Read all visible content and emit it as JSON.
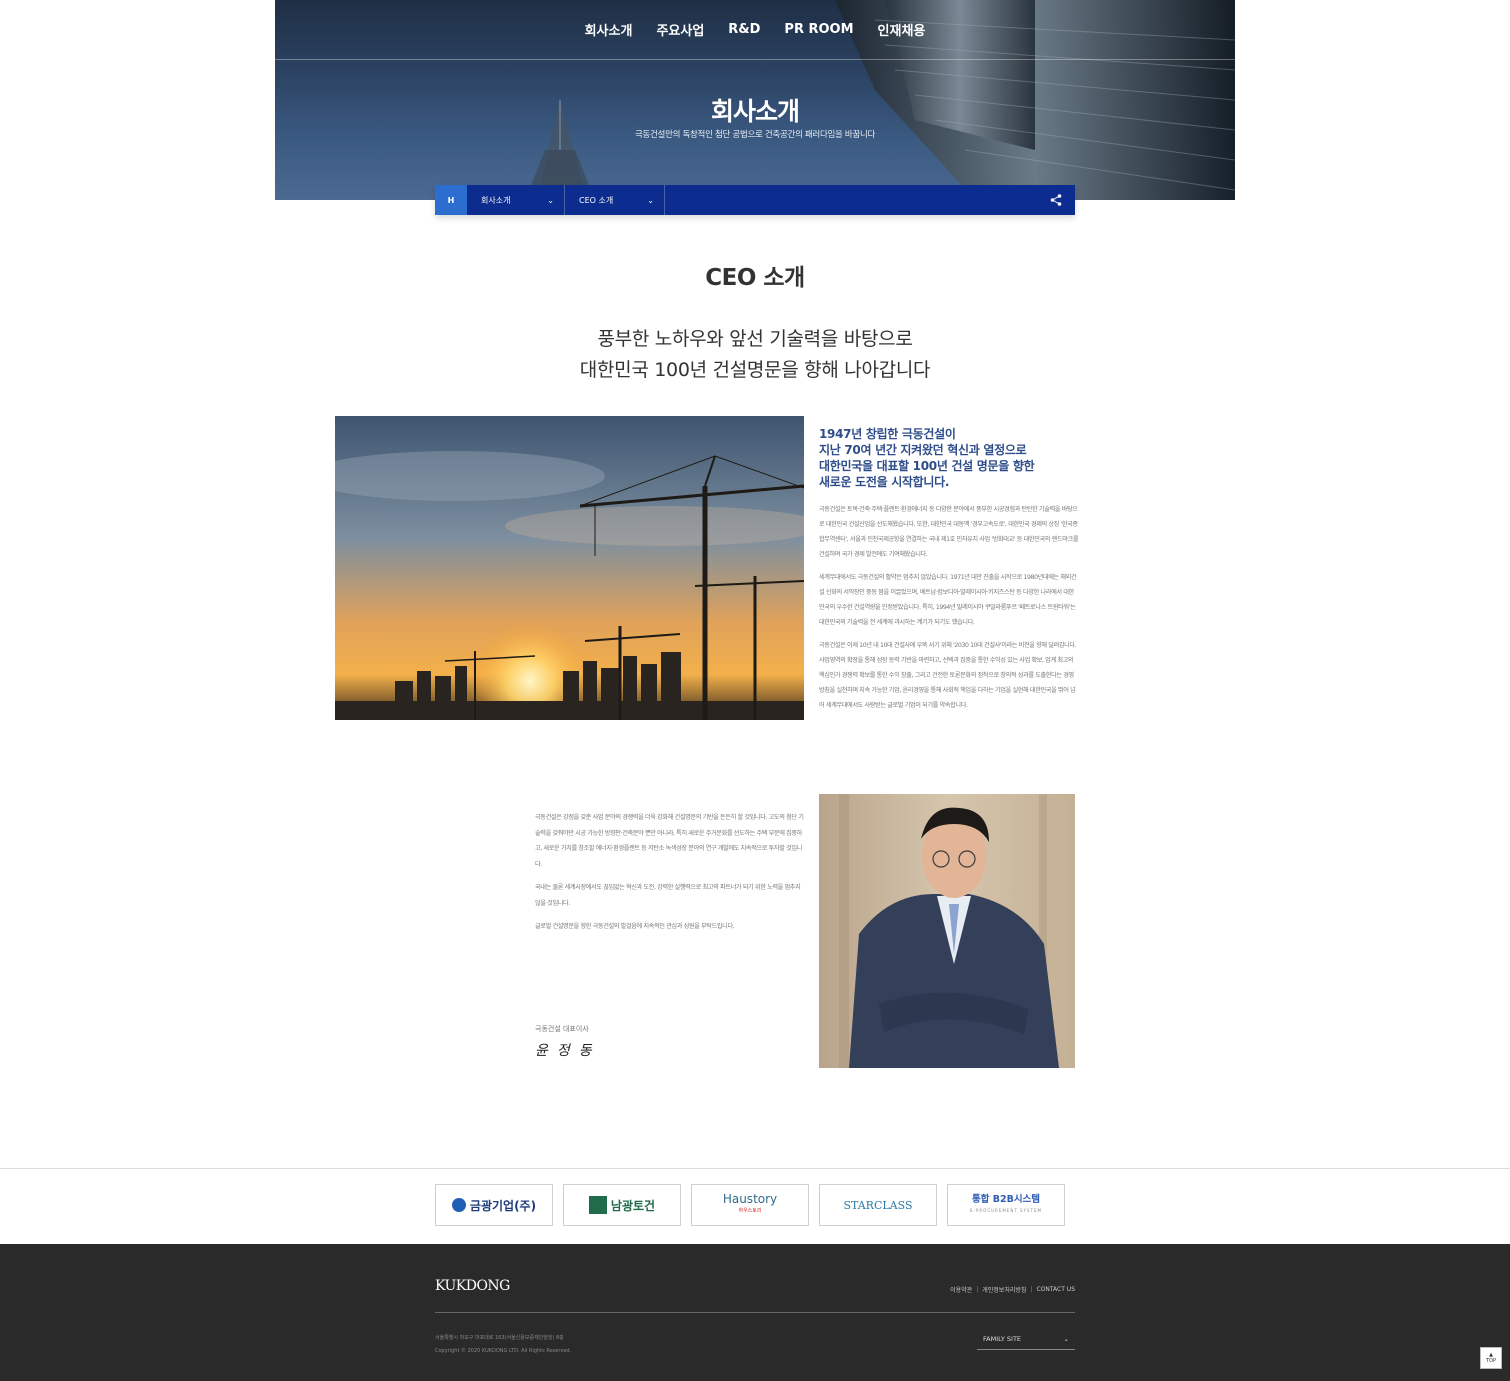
{
  "nav": {
    "items": [
      "회사소개",
      "주요사업",
      "R&D",
      "PR ROOM",
      "인재채용"
    ]
  },
  "hero": {
    "title": "회사소개",
    "subtitle": "극동건설만의 독창적인 첨단 공법으로 건축공간의 패러다임을 바꿉니다"
  },
  "location": {
    "home": "H",
    "depth1": "회사소개",
    "depth2": "CEO 소개"
  },
  "page": {
    "heading": "CEO 소개",
    "tagline_1": "풍부한 노하우와 앞선 기술력을 바탕으로",
    "tagline_2": "대한민국 100년 건설명문을 향해 나아갑니다"
  },
  "intro": {
    "headline": [
      "1947년 창립한 극동건설이",
      "지난 70여 년간 지켜왔던 혁신과 열정으로",
      "대한민국을 대표할 100년 건설 명문을 향한",
      "새로운 도전을 시작합니다."
    ],
    "paragraphs": [
      "극동건설은 토목·건축·주택·플랜트·환경에너지 등 다양한 분야에서 풍부한 시공경험과 탄탄한 기술력을 바탕으로 대한민국 건설산업을 선도해왔습니다. 또한, 대한민국 대동맥 '경부고속도로', 대한민국 경제의 상징 '한국종합무역센터', 서울과 인천국제공항을 연결하는 국내 제1호 민자유치 사업 '방화대교' 등 대한민국의 랜드마크를 건설하며 국가 경제 발전에도 기여해왔습니다.",
      "세계무대에서도 극동건설의 활약은 멈추지 않았습니다. 1971년 대만 진출을 시작으로 1980년대에는 해외건설 신화의 서막장인 중동 붐을 이끌었으며, 베트남·캄보디아·말레이시아·키지즈스탄 등 다양한 나라에서 대한민국의 우수한 건설역량을 인정받았습니다. 특히, 1994년 말레이시아 쿠알라룸푸르 '페트로나스 트윈타워'는 대한민국의 기술력을 전 세계에 과시하는 계기가 되기도 했습니다.",
      "극동건설은 이제 10년 내 10대 건설사에 우뚝 서기 위해 '2030 10대 건설사'이라는 비전을 향해 달려갑니다. 사업영역의 확장을 통해 성장 동력 기반을 마련하고, 선택과 집중을 통한 수익성 있는 사업 확보, 업계 최고의 핵심인가 경쟁력 확보를 통한 수익 창출, 그리고 건전한 토론문화의 정착으로 창의적 성과를 도출한다는 경영 방침을 실천하며 지속 가능한 기업, 윤리경영을 통해 사회적 책임을 다하는 기업을 실현해 대한민국을 뛰어 넘어 세계무대에서도 사랑받는 글로벌 기업이 되기를 약속합니다."
    ]
  },
  "message": {
    "paragraphs": [
      "극동건설은 강점을 갖춘 사업 분야의 경쟁력을 더욱 강화해 건설명문의 기반을 든든히 할 것입니다. 고도의 첨단 기술력을 갖춰야만 시공 가능한 방향판·건축분야 뿐만 아니라, 특히 새로운 주거문화를 선도하는 주택 부문에 집중하고, 새로운 가치를 창조할 에너지·환경플랜트 등 저탄소 녹색성장 분야의 연구 개발에도 지속적으로 투자할 것입니다.",
      "국내는 물론 세계시장에서도 끊임없는 혁신과 도전, 강력한 실행력으로 최고의 파트너가 되기 위한 노력을 멈추지 않을 것입니다.",
      "글로벌 건설명문을 향한 극동건설의 발걸음에 지속적인 관심과 성원을 부탁드립니다."
    ],
    "signature_title": "극동건설 대표이사",
    "signature": "윤정동"
  },
  "partners": [
    "금광기업(주)",
    "남광토건",
    "Haustory",
    "STARCLASS",
    "통합 B2B시스템"
  ],
  "partner_sub": {
    "haustory": "하우스토리",
    "b2b": "E-PROCUREMENT SYSTEM"
  },
  "footer": {
    "logo": "KUKDONG",
    "links": [
      "이용약관",
      "개인정보처리방침",
      "CONTACT US"
    ],
    "address": "서울특별시 마포구 마포대로 163(서울신용보증재단빌딩) 8층",
    "copyright": "Copyright © 2020 KUKDONG LTD. All Rights Reserved.",
    "family_site": "FAMILY SITE"
  },
  "top_button": "TOP",
  "colors": {
    "nav_bar": "#0c2d8f",
    "home_tab": "#2b6ed0",
    "accent_text": "#2f4d8a",
    "footer_bg": "#2a2a2a"
  }
}
